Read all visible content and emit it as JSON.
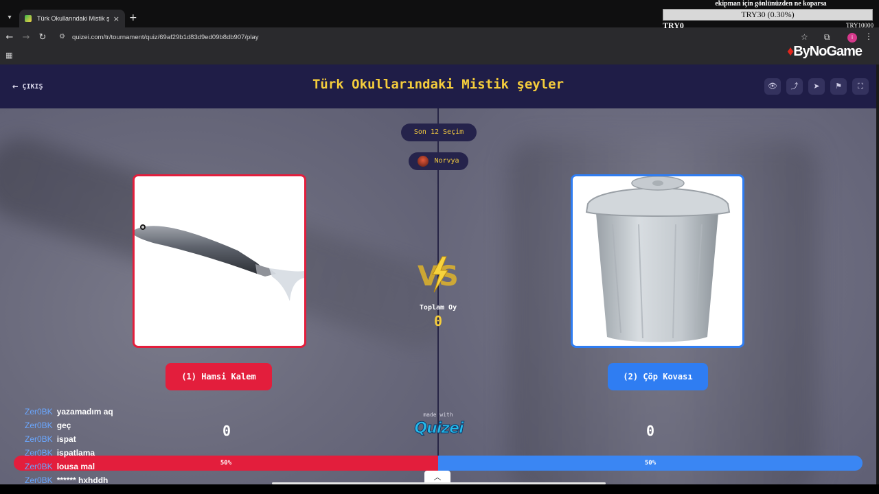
{
  "browser": {
    "tab_title": "Türk Okullarındaki Mistik şeyler",
    "new_tab": "+",
    "close": "×",
    "url": "quizei.com/tr/tournament/quiz/69af29b1d83d9ed09b8db907/play",
    "profile_initial": "i"
  },
  "overlay": {
    "donation_message": "ekipman için gönlünüzden ne koparsa",
    "donation_progress": "TRY30 (0.30%)",
    "donation_min": "TRY0",
    "donation_max": "TRY10000",
    "sponsor": "ByNoGame"
  },
  "quiz": {
    "exit_label": "ÇIKIŞ",
    "title": "Türk Okullarındaki Mistik şeyler",
    "round_label": "Son 12 Seçim",
    "player_name": "Norvya",
    "total_votes_label": "Toplam Oy",
    "total_votes": "0",
    "made_with": "made with",
    "brand": "Quizei",
    "left": {
      "label": "(1) Hamsi Kalem",
      "votes": "0",
      "percent_label": "50%",
      "percent": 50,
      "color": "#e31e3c"
    },
    "right": {
      "label": "(2) Çöp Kovası",
      "votes": "0",
      "percent_label": "50%",
      "percent": 50,
      "color": "#2f7df2"
    }
  },
  "chat": [
    {
      "user": "Zer0BK",
      "message": "yazamadım aq"
    },
    {
      "user": "Zer0BK",
      "message": "geç"
    },
    {
      "user": "Zer0BK",
      "message": "ispat"
    },
    {
      "user": "Zer0BK",
      "message": "ispatlama"
    },
    {
      "user": "Zer0BK",
      "message": "lousa mal"
    },
    {
      "user": "Zer0BK",
      "message": "****** hxhddh"
    }
  ],
  "icons": {
    "eye": "👁",
    "share": "⤴",
    "send": "➤",
    "flag": "⚑",
    "fullscreen": "⛶"
  }
}
